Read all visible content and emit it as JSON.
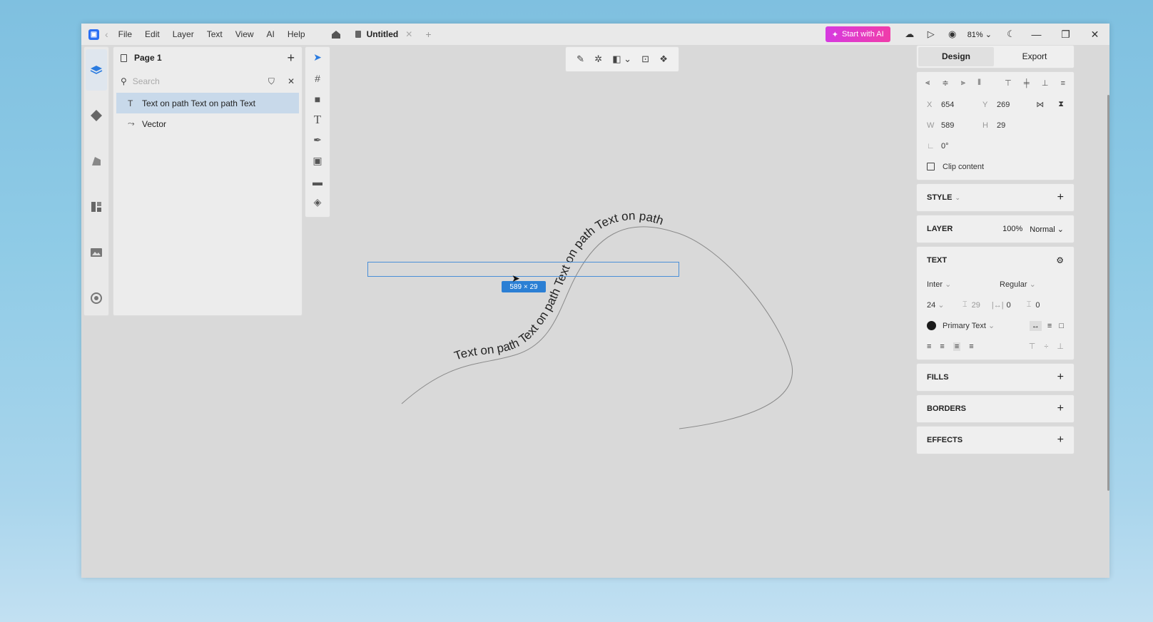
{
  "titlebar": {
    "menu": [
      "File",
      "Edit",
      "Layer",
      "Text",
      "View",
      "AI",
      "Help"
    ],
    "tab_title": "Untitled",
    "ai_button": "Start with AI",
    "zoom": "81%"
  },
  "layers": {
    "page_name": "Page 1",
    "search_placeholder": "Search",
    "items": [
      {
        "label": "Text on path Text on path Text",
        "icon": "T"
      },
      {
        "label": "Vector",
        "icon": "⤳"
      }
    ]
  },
  "canvas": {
    "path_text": "Text on path Text on path Text on path Text on path",
    "size_badge": "589 × 29"
  },
  "right_panel": {
    "tabs": [
      "Design",
      "Export"
    ],
    "x_label": "X",
    "x": "654",
    "y_label": "Y",
    "y": "269",
    "w_label": "W",
    "w": "589",
    "h_label": "H",
    "h": "29",
    "rotation": "0°",
    "clip_content": "Clip content",
    "style_title": "STYLE",
    "layer_title": "LAYER",
    "layer_opacity": "100%",
    "layer_blend": "Normal",
    "text_title": "TEXT",
    "font_family": "Inter",
    "font_weight": "Regular",
    "font_size": "24",
    "line_height": "29",
    "letter_spacing": "0",
    "paragraph_spacing": "0",
    "color_name": "Primary Text",
    "fills_title": "FILLS",
    "borders_title": "BORDERS",
    "effects_title": "EFFECTS"
  }
}
